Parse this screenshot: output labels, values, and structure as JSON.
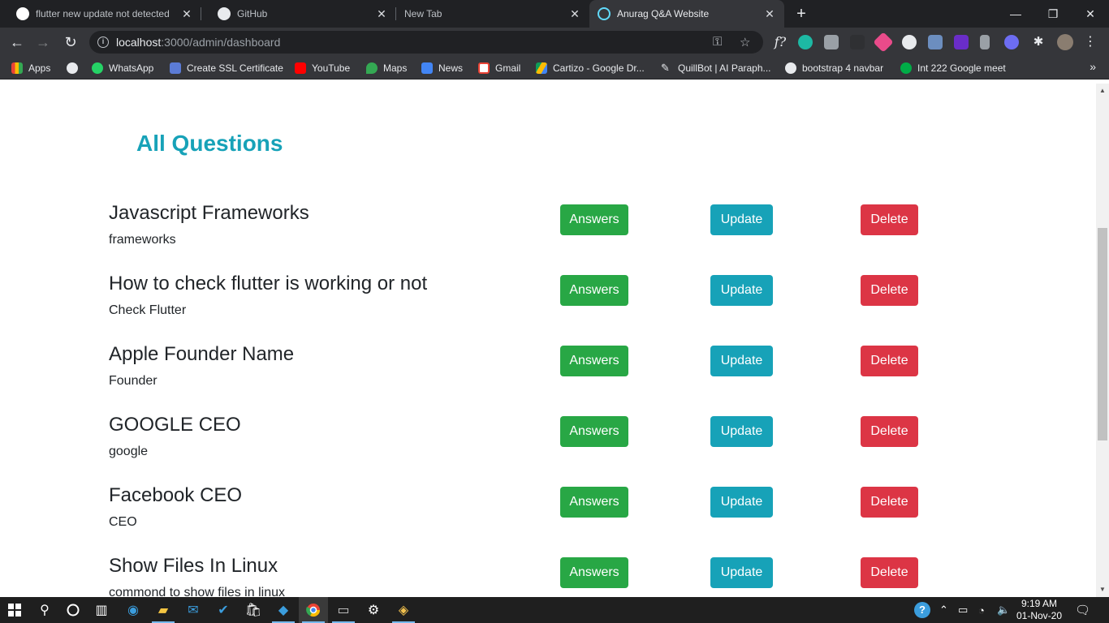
{
  "browser": {
    "tabs": [
      {
        "title": "flutter new update not detected",
        "icon": "google-icon",
        "color": "#4285f4"
      },
      {
        "title": "GitHub",
        "icon": "github-icon",
        "color": "#e8eaed"
      },
      {
        "title": "New Tab",
        "icon": "",
        "color": ""
      },
      {
        "title": "Anurag Q&A Website",
        "icon": "react-icon",
        "color": "#61dafb"
      }
    ],
    "url_host": "localhost",
    "url_path": ":3000/admin/dashboard",
    "bookmarks": [
      {
        "label": "Apps",
        "icon": "apps-grid-icon",
        "color": "#ea4335"
      },
      {
        "label": "",
        "icon": "globe-icon",
        "color": "#e8eaed"
      },
      {
        "label": "WhatsApp",
        "icon": "whatsapp-icon",
        "color": "#25d366"
      },
      {
        "label": "Create SSL Certificate",
        "icon": "puzzle-icon",
        "color": "#5b7bd5"
      },
      {
        "label": "YouTube",
        "icon": "youtube-icon",
        "color": "#ff0000"
      },
      {
        "label": "Maps",
        "icon": "maps-pin-icon",
        "color": "#34a853"
      },
      {
        "label": "News",
        "icon": "news-icon",
        "color": "#4285f4"
      },
      {
        "label": "Gmail",
        "icon": "gmail-icon",
        "color": "#ea4335"
      },
      {
        "label": "Cartizo - Google Dr...",
        "icon": "drive-icon",
        "color": "#fbbc04"
      },
      {
        "label": "QuillBot | AI Paraph...",
        "icon": "quill-icon",
        "color": "#e8eaed"
      },
      {
        "label": "bootstrap 4 navbar",
        "icon": "github-icon",
        "color": "#e8eaed"
      },
      {
        "label": "Int 222 Google meet",
        "icon": "meet-icon",
        "color": "#00ac47"
      }
    ]
  },
  "main": {
    "title": "All Questions",
    "buttons": {
      "answers": "Answers",
      "update": "Update",
      "delete": "Delete"
    },
    "questions": [
      {
        "title": "Javascript Frameworks",
        "subtitle": "frameworks"
      },
      {
        "title": "How to check flutter is working or not",
        "subtitle": "Check Flutter"
      },
      {
        "title": "Apple Founder Name",
        "subtitle": "Founder"
      },
      {
        "title": "GOOGLE CEO",
        "subtitle": "google"
      },
      {
        "title": "Facebook CEO",
        "subtitle": "CEO"
      },
      {
        "title": "Show Files In Linux",
        "subtitle": "commond to show files in linux"
      }
    ]
  },
  "taskbar": {
    "time": "9:19 AM",
    "date": "01-Nov-20"
  },
  "colors": {
    "title": "#17a2b8",
    "answers": "#28a745",
    "update": "#17a2b8",
    "delete": "#dc3545"
  }
}
